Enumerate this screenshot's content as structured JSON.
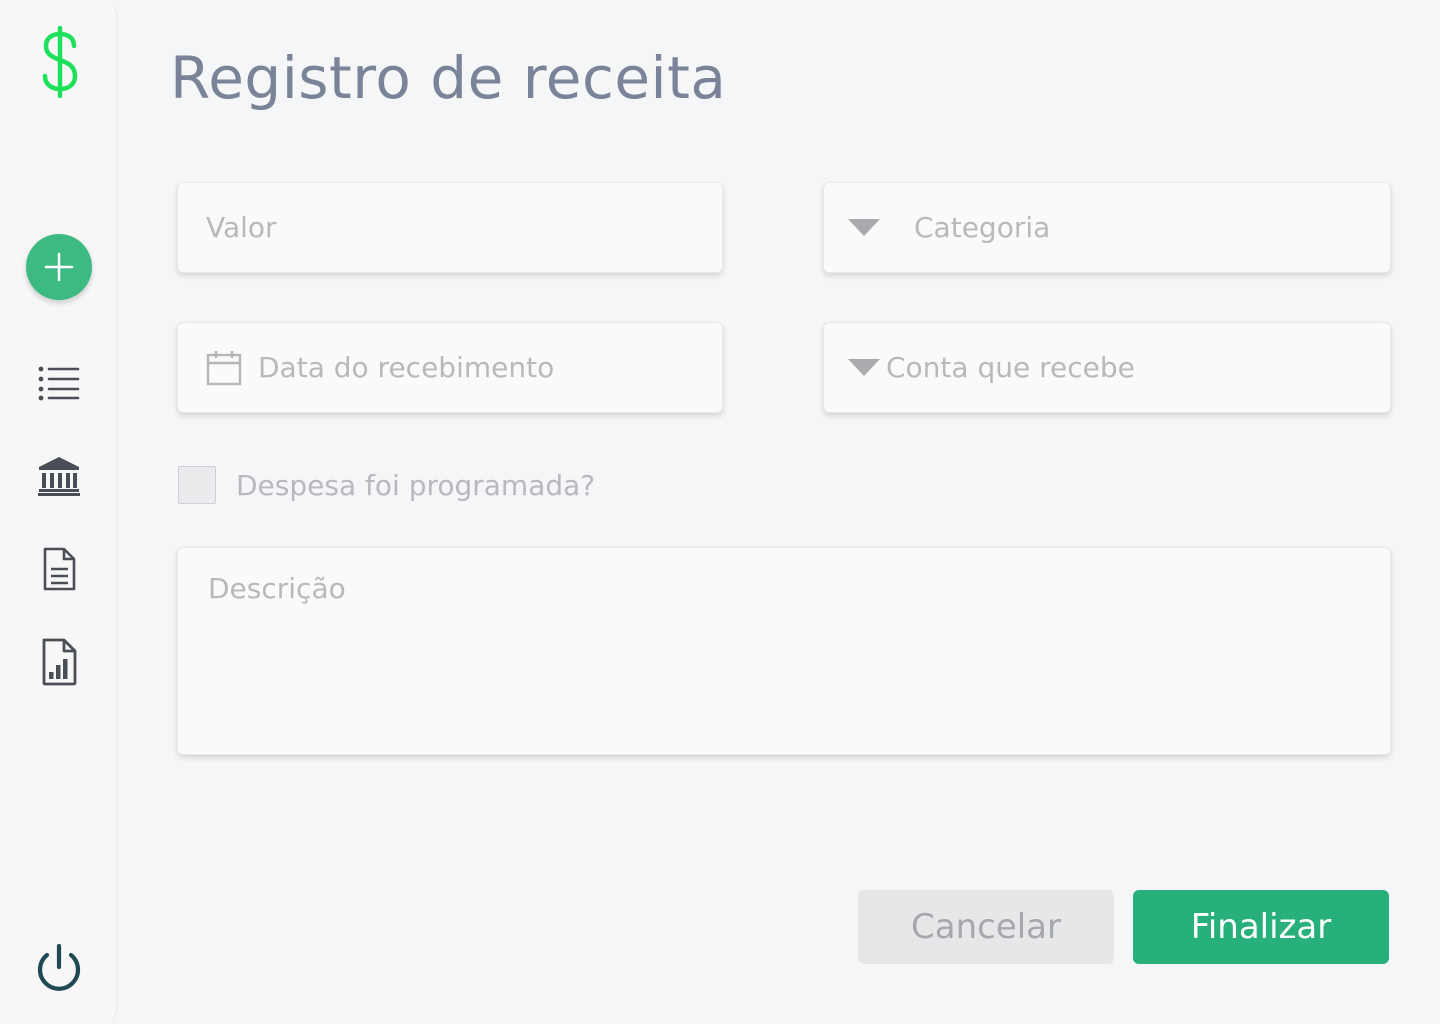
{
  "sidebar": {
    "logo_icon": "dollar-sign-icon",
    "items": [
      {
        "icon": "plus-icon",
        "label": "Adicionar"
      },
      {
        "icon": "list-icon",
        "label": "Lista"
      },
      {
        "icon": "bank-icon",
        "label": "Contas"
      },
      {
        "icon": "document-icon",
        "label": "Documentos"
      },
      {
        "icon": "report-chart-icon",
        "label": "Relatórios"
      }
    ],
    "logout_icon": "power-icon"
  },
  "page": {
    "title": "Registro de receita"
  },
  "form": {
    "valor": {
      "placeholder": "Valor",
      "value": ""
    },
    "categoria": {
      "placeholder": "Categoria",
      "icon": "caret-down-icon"
    },
    "data": {
      "placeholder": "Data do recebimento",
      "icon": "calendar-icon",
      "value": ""
    },
    "conta": {
      "placeholder": "Conta que recebe",
      "icon": "caret-down-icon"
    },
    "programada": {
      "label": "Despesa foi programada?",
      "checked": false
    },
    "descricao": {
      "placeholder": "Descrição",
      "value": ""
    }
  },
  "actions": {
    "cancel_label": "Cancelar",
    "finish_label": "Finalizar"
  },
  "colors": {
    "brand_green": "#28b07b",
    "logo_green": "#1ee05a",
    "title_gray": "#7b8398",
    "power_dark": "#1f4a52"
  }
}
